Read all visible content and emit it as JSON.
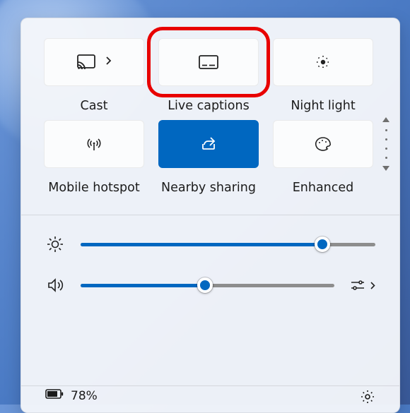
{
  "tiles": [
    {
      "id": "cast",
      "label": "Cast",
      "active": false,
      "highlighted": false,
      "has_more": true
    },
    {
      "id": "live-captions",
      "label": "Live captions",
      "active": false,
      "highlighted": true,
      "has_more": false
    },
    {
      "id": "night-light",
      "label": "Night light",
      "active": false,
      "highlighted": false,
      "has_more": false
    },
    {
      "id": "mobile-hotspot",
      "label": "Mobile hotspot",
      "active": false,
      "highlighted": false,
      "has_more": false
    },
    {
      "id": "nearby-sharing",
      "label": "Nearby sharing",
      "active": true,
      "highlighted": false,
      "has_more": false
    },
    {
      "id": "enhanced",
      "label": "Enhanced",
      "active": false,
      "highlighted": false,
      "has_more": false
    }
  ],
  "sliders": {
    "brightness": {
      "percent": 82
    },
    "volume": {
      "percent": 49,
      "has_output_selector": true
    }
  },
  "footer": {
    "battery_percent_text": "78%"
  }
}
